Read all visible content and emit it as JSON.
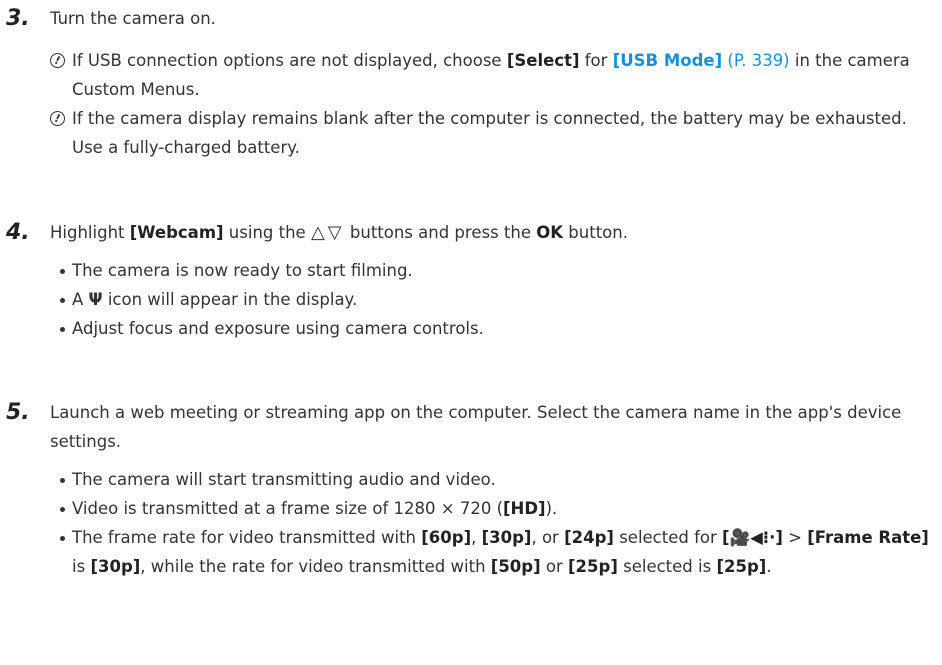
{
  "step3": {
    "number": "3.",
    "text": "Turn the camera on.",
    "note1": {
      "pre": "If USB connection options are not displayed, choose ",
      "select": "[Select]",
      "mid": " for ",
      "usb_mode": "[USB Mode]",
      "page_ref": " (P. 339)",
      "post": " in the camera Custom Menus."
    },
    "note2": "If the camera display remains blank after the computer is connected, the battery may be exhausted. Use a fully-charged battery."
  },
  "step4": {
    "number": "4.",
    "pre": "Highlight ",
    "webcam": "[Webcam]",
    "mid": " using the ",
    "arrows": "△▽",
    "mid2": " buttons and press the ",
    "ok": "OK",
    "post": " button.",
    "bullets": {
      "b1": "The camera is now ready to start filming.",
      "b2_pre": "A ",
      "b2_icon": "Ψ",
      "b2_post": " icon will appear in the display.",
      "b3": "Adjust focus and exposure using camera controls."
    }
  },
  "step5": {
    "number": "5.",
    "text": "Launch a web meeting or streaming app on the computer. Select the camera name in the app's device settings.",
    "bullets": {
      "b1": "The camera will start transmitting audio and video.",
      "b2_pre": "Video is transmitted at a frame size of 1280 × 720 (",
      "b2_hd": "[HD]",
      "b2_post": ").",
      "b3_pre": "The frame rate for video transmitted with ",
      "b3_60p": "[60p]",
      "b3_c1": ", ",
      "b3_30p": "[30p]",
      "b3_c2": ", or ",
      "b3_24p": "[24p]",
      "b3_c3": " selected for ",
      "b3_menu": "[🎥◀⁝·]",
      "b3_gt": " > ",
      "b3_framerate": "[Frame Rate]",
      "b3_is": " is ",
      "b3_30p2": "[30p]",
      "b3_c4": ", while the rate for video transmitted with ",
      "b3_50p": "[50p]",
      "b3_or": " or ",
      "b3_25p": "[25p]",
      "b3_c5": " selected is ",
      "b3_25p2": "[25p]",
      "b3_end": "."
    }
  }
}
